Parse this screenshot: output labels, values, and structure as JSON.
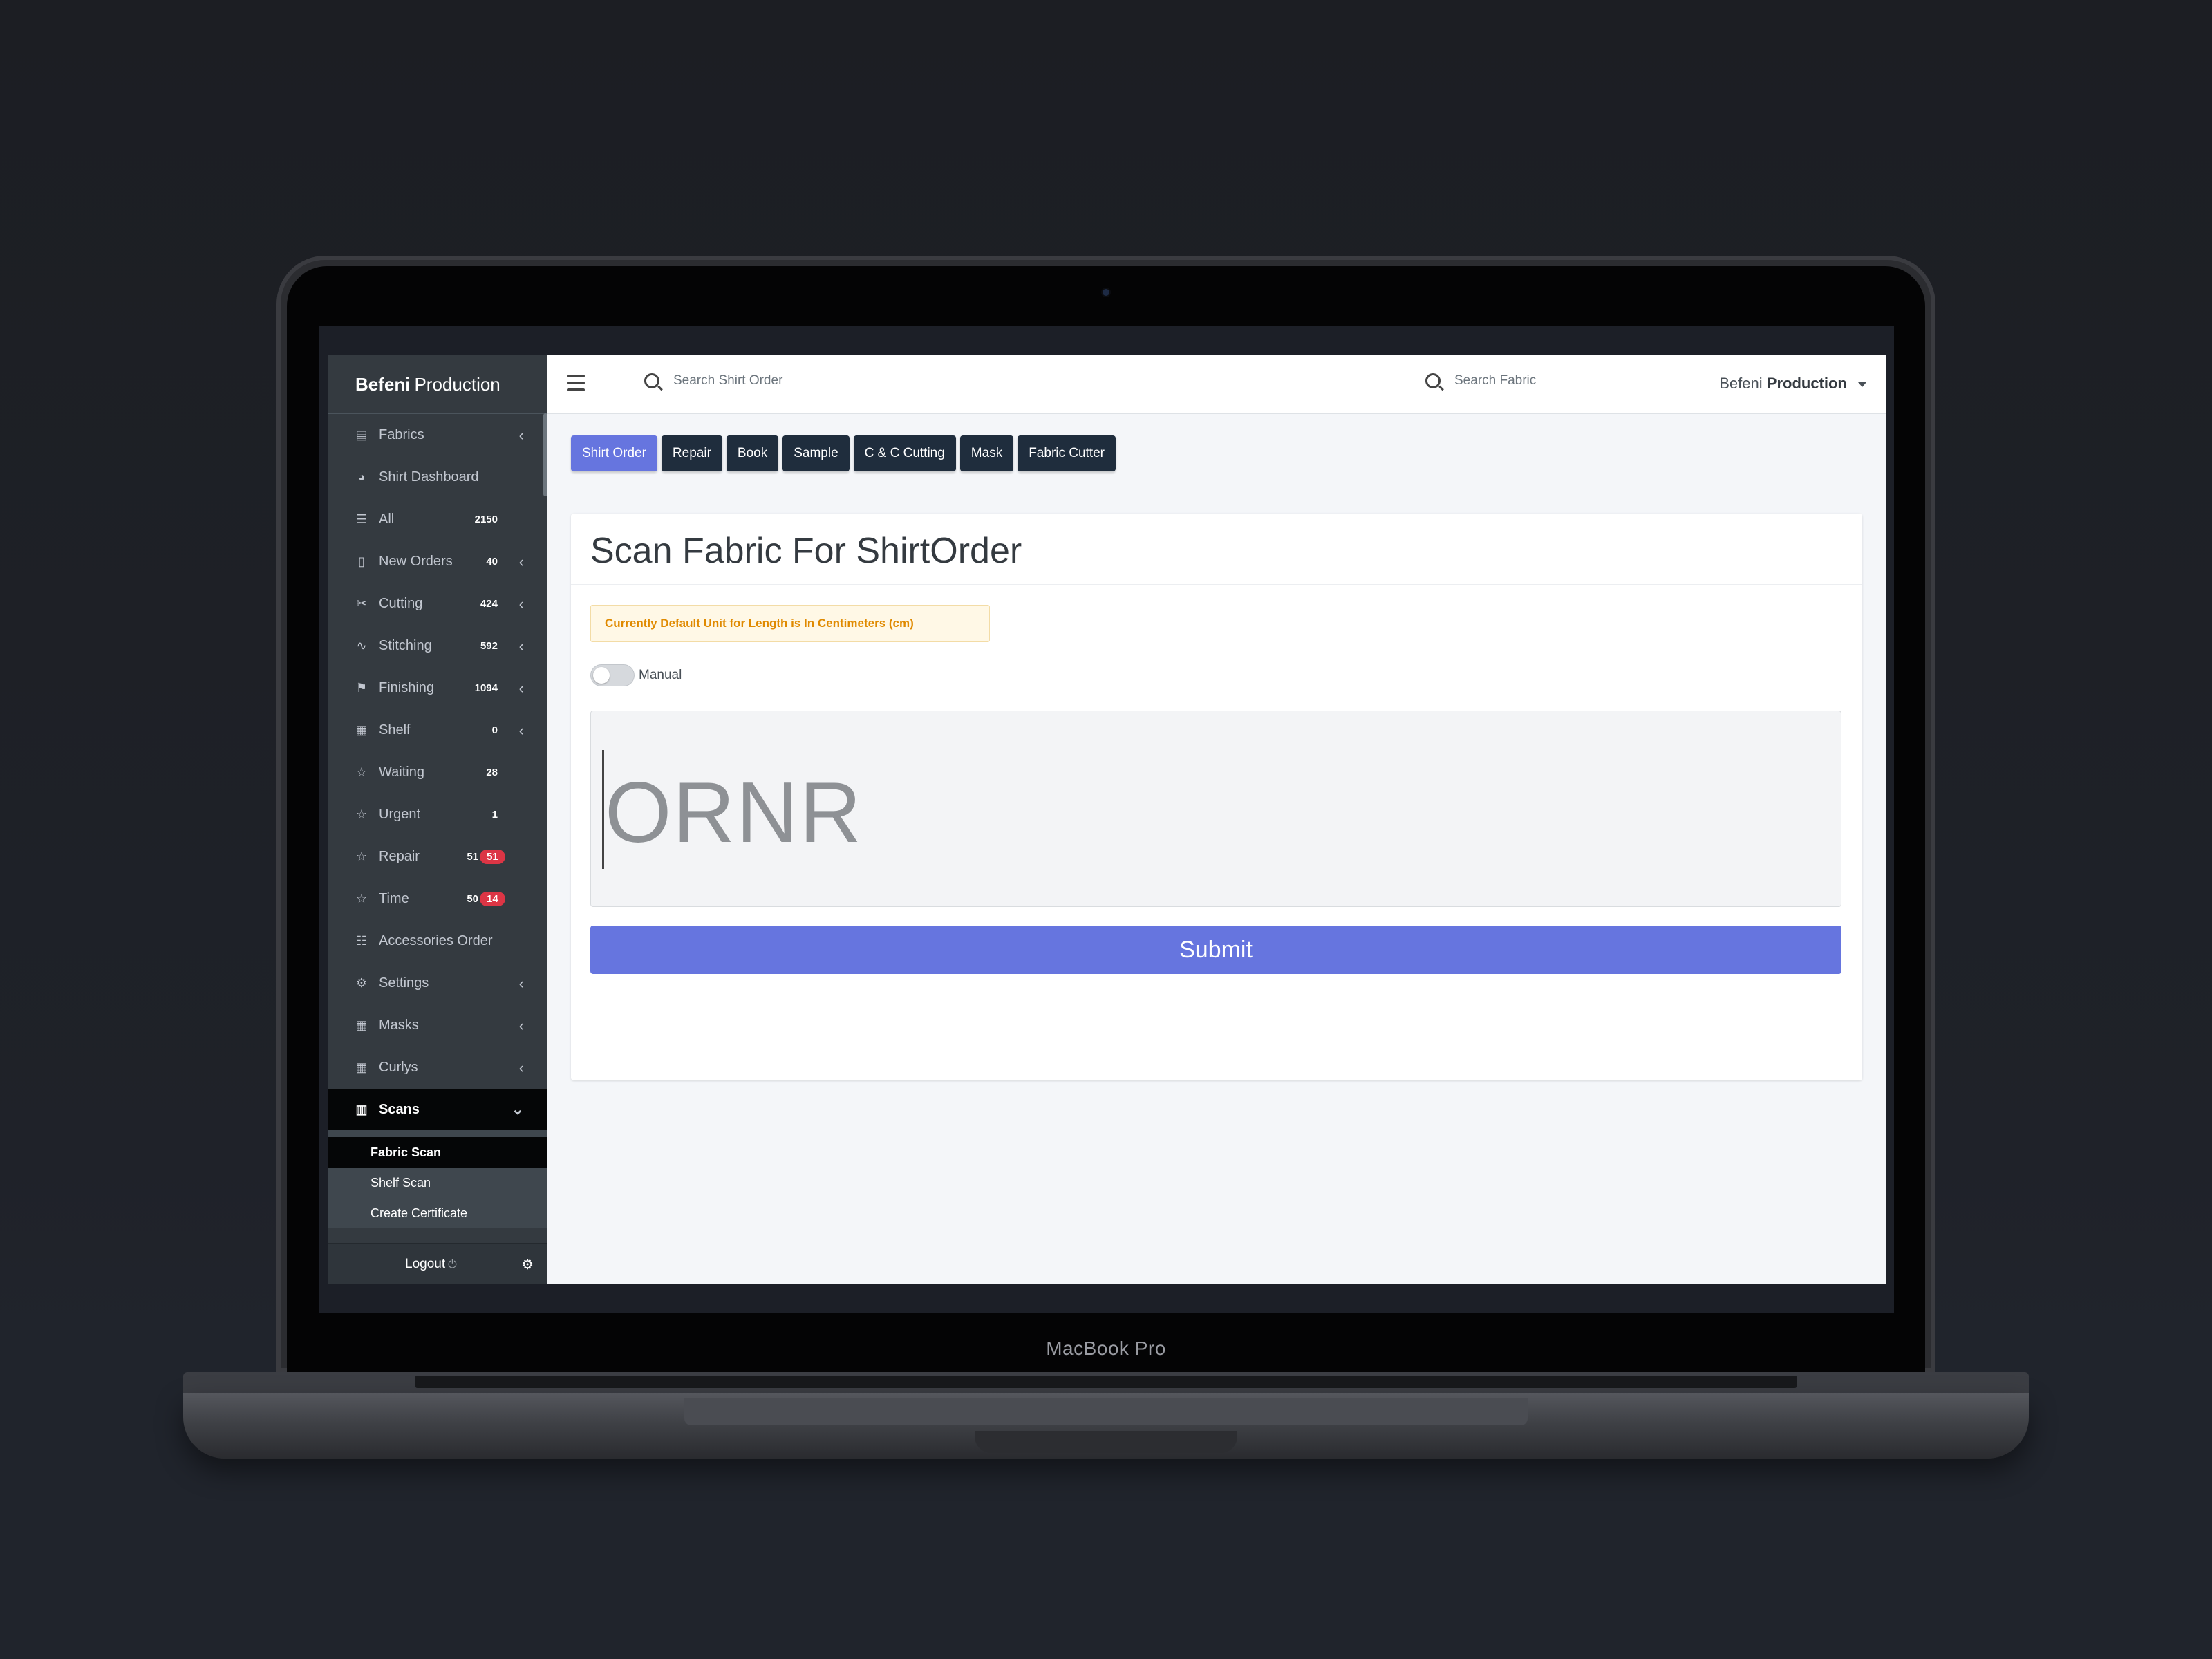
{
  "device": {
    "label": "MacBook Pro"
  },
  "brand": {
    "bold": "Befeni",
    "normal": "Production"
  },
  "sidebar": {
    "items": [
      {
        "label": "Fabrics",
        "icon": "file-icon",
        "chevron": true
      },
      {
        "label": "Shirt Dashboard",
        "icon": "dashboard-icon"
      },
      {
        "label": "All",
        "icon": "list-icon",
        "count": "2150"
      },
      {
        "label": "New Orders",
        "icon": "file-outline-icon",
        "count": "40",
        "chevron": true
      },
      {
        "label": "Cutting",
        "icon": "scissors-icon",
        "count": "424",
        "chevron": true
      },
      {
        "label": "Stitching",
        "icon": "stitch-icon",
        "count": "592",
        "chevron": true
      },
      {
        "label": "Finishing",
        "icon": "flag-icon",
        "count": "1094",
        "chevron": true
      },
      {
        "label": "Shelf",
        "icon": "shelf-icon",
        "count": "0",
        "chevron": true
      },
      {
        "label": "Waiting",
        "icon": "star-icon",
        "count": "28"
      },
      {
        "label": "Urgent",
        "icon": "star-icon",
        "count": "1"
      },
      {
        "label": "Repair",
        "icon": "star-icon",
        "count": "51",
        "badge": "51"
      },
      {
        "label": "Time",
        "icon": "star-icon",
        "count": "50",
        "badge": "14"
      },
      {
        "label": "Accessories Order",
        "icon": "list-alt-icon"
      },
      {
        "label": "Settings",
        "icon": "gear-icon",
        "chevron": true
      },
      {
        "label": "Masks",
        "icon": "shelf-icon",
        "chevron": true
      },
      {
        "label": "Curlys",
        "icon": "shelf-icon",
        "chevron": true
      }
    ],
    "scans": {
      "label": "Scans",
      "icon": "barcode-icon"
    },
    "sub": [
      "Fabric Scan",
      "Shelf Scan",
      "Create Certificate"
    ],
    "logout": "Logout"
  },
  "topbar": {
    "search_order_placeholder": "Search Shirt Order",
    "search_fabric_placeholder": "Search Fabric",
    "user_normal": "Befeni",
    "user_bold": "Production"
  },
  "tabs": [
    "Shirt Order",
    "Repair",
    "Book",
    "Sample",
    "C & C Cutting",
    "Mask",
    "Fabric Cutter"
  ],
  "card": {
    "title": "Scan Fabric For ShirtOrder",
    "alert": "Currently Default Unit for Length is In Centimeters (cm)",
    "toggle_label": "Manual",
    "scan_value": "ORNR",
    "submit": "Submit"
  },
  "colors": {
    "sidebar": "#343a40",
    "accent": "#6675df",
    "tab": "#1f2d3d",
    "badge": "#dc3545",
    "alert_text": "#e08a00"
  }
}
